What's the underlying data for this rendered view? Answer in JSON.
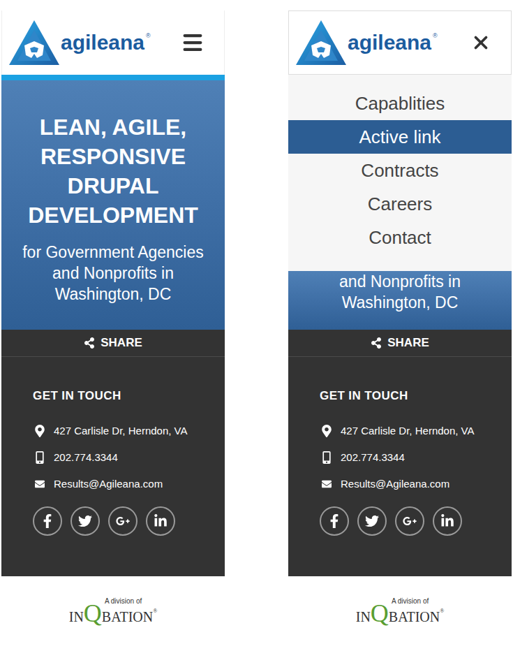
{
  "brand": {
    "name": "agileana",
    "mark": "®"
  },
  "screens": [
    {
      "menu_open": false,
      "hero_title_lines": [
        "LEAN, AGILE,",
        "RESPONSIVE",
        "DRUPAL",
        "DEVELOPMENT"
      ],
      "hero_subtitle_lines": [
        "for Government Agencies",
        "and Nonprofits in",
        "Washington, DC"
      ]
    },
    {
      "menu_open": true,
      "hero_title_lines": [],
      "hero_subtitle_lines": [
        "and Nonprofits in",
        "Washington, DC"
      ]
    }
  ],
  "menu": {
    "items": [
      {
        "label": "Capablities",
        "selected": false
      },
      {
        "label": "Active link",
        "selected": true
      },
      {
        "label": "Contracts",
        "selected": false
      },
      {
        "label": "Careers",
        "selected": false
      },
      {
        "label": "Contact",
        "selected": false
      }
    ]
  },
  "share": {
    "label": "SHARE"
  },
  "contact": {
    "heading": "GET IN TOUCH",
    "items": [
      {
        "kind": "address",
        "text": "427 Carlisle Dr, Herndon, VA"
      },
      {
        "kind": "phone",
        "text": "202.774.3344"
      },
      {
        "kind": "email",
        "text": "Results@Agileana.com"
      }
    ]
  },
  "footer": {
    "division": "A division of",
    "name_start": "IN",
    "name_q": "Q",
    "name_end": "BATION",
    "mark": "®"
  }
}
